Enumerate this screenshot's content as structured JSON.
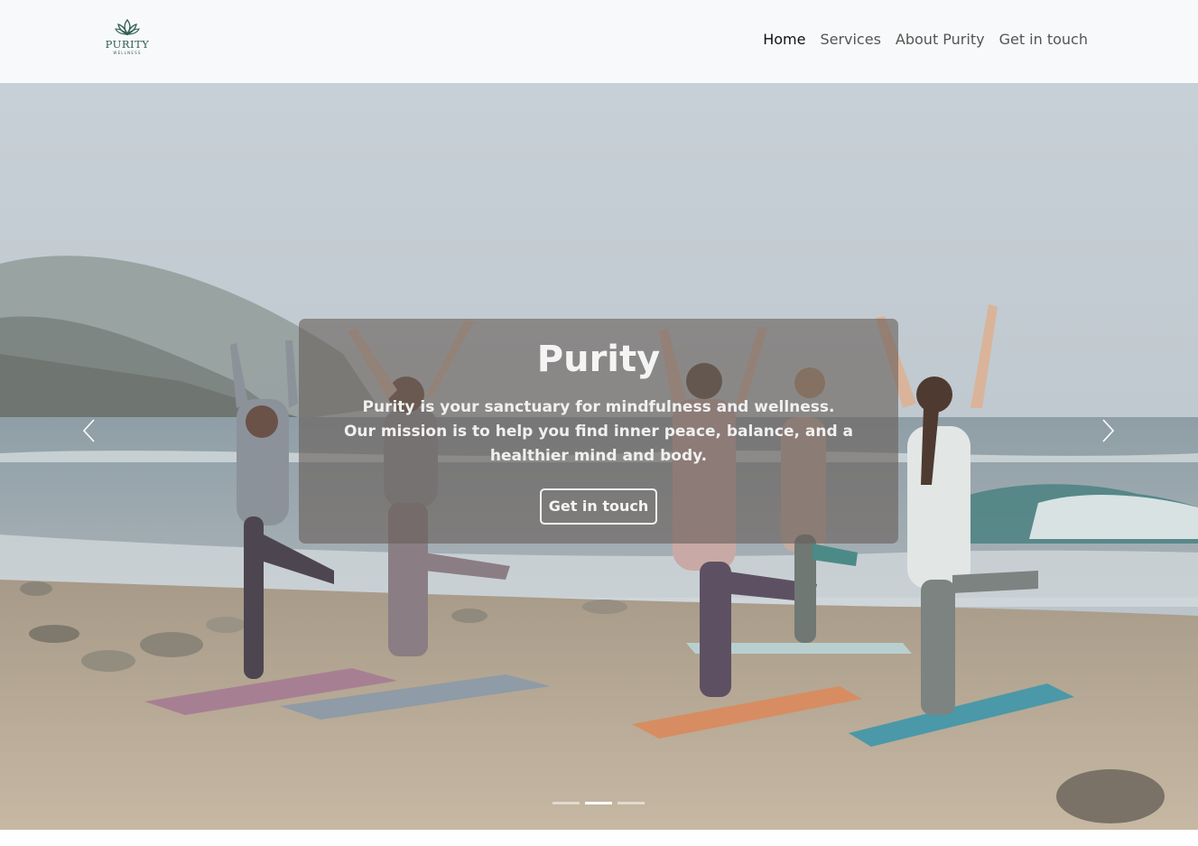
{
  "brand": {
    "name": "PURITY",
    "tagline": "WELLNESS",
    "color": "#2e5e4e"
  },
  "nav": {
    "items": [
      {
        "label": "Home",
        "active": true
      },
      {
        "label": "Services",
        "active": false
      },
      {
        "label": "About Purity",
        "active": false
      },
      {
        "label": "Get in touch",
        "active": false
      }
    ]
  },
  "hero": {
    "title": "Purity",
    "line1": "Purity is your sanctuary for mindfulness and wellness.",
    "line2": "Our mission is to help you find inner peace, balance, and a healthier mind and body.",
    "button_label": "Get in touch",
    "prev_icon": "chevron-left-icon",
    "next_icon": "chevron-right-icon",
    "slide_count": 3,
    "active_slide": 2
  }
}
